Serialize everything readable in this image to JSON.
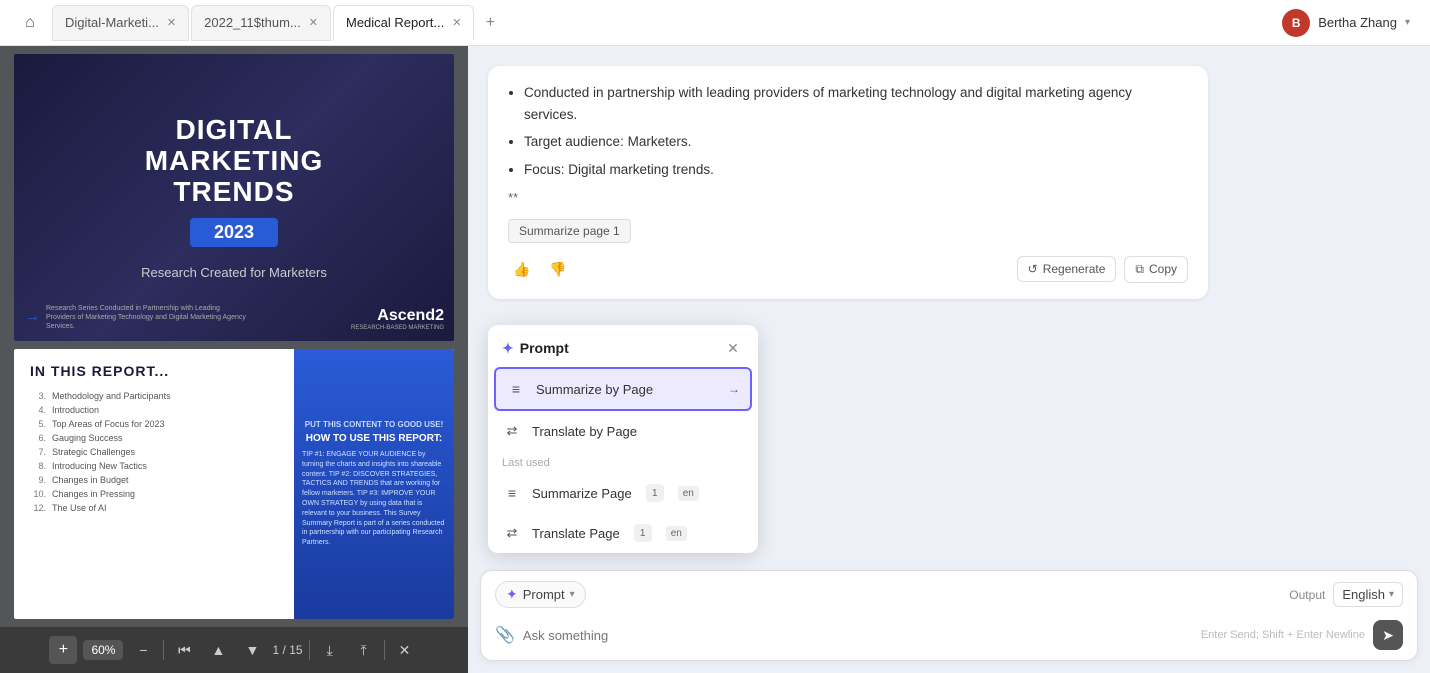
{
  "topbar": {
    "home_icon": "⌂",
    "tabs": [
      {
        "id": "tab-digital",
        "label": "Digital-Marketi...",
        "active": false,
        "closable": true
      },
      {
        "id": "tab-2022",
        "label": "2022_11$thum...",
        "active": false,
        "closable": true
      },
      {
        "id": "tab-medical",
        "label": "Medical Report...",
        "active": true,
        "closable": true
      }
    ],
    "add_tab_icon": "+",
    "user": {
      "initials": "B",
      "name": "Bertha Zhang",
      "chevron": "▾"
    }
  },
  "pdf": {
    "page1": {
      "title": "DIGITAL\nMARKETING\nTRENDS",
      "year": "2023",
      "subtitle": "Research Created for Marketers",
      "footer_left": "Research Series Conducted in Partnership with Leading Providers of Marketing Technology and Digital Marketing Agency Services.",
      "logo": "Ascend2",
      "logo_sub": "RESEARCH-BASED MARKETING"
    },
    "page2": {
      "header": "IN THIS REPORT...",
      "toc": [
        {
          "num": "3.",
          "label": "Methodology and Participants"
        },
        {
          "num": "4.",
          "label": "Introduction"
        },
        {
          "num": "5.",
          "label": "Top Areas of Focus for 2023"
        },
        {
          "num": "6.",
          "label": "Gauging Success"
        },
        {
          "num": "7.",
          "label": "Strategic Challenges"
        },
        {
          "num": "8.",
          "label": "Introducing New Tactics"
        },
        {
          "num": "9.",
          "label": "Changes in Budget"
        },
        {
          "num": "10.",
          "label": "Changes in Pressing"
        },
        {
          "num": "12.",
          "label": "The Use of AI"
        }
      ],
      "inset_label": "PUT THIS CONTENT TO GOOD USE!",
      "inset_title": "HOW TO USE THIS REPORT:",
      "inset_body": "TIP #1: ENGAGE YOUR AUDIENCE by turning the charts and insights into shareable content.\n\nTIP #2: DISCOVER STRATEGIES, TACTICS AND TRENDS that are working for fellow marketers.\n\nTIP #3: IMPROVE YOUR OWN STRATEGY by using data that is relevant to your business.\n\nThis Survey Summary Report is part of a series conducted in partnership with our participating Research Partners."
    },
    "toolbar": {
      "zoom": "60%",
      "page_current": "1",
      "page_total": "15"
    }
  },
  "chat": {
    "bubble": {
      "bullets": [
        "Conducted in partnership with leading providers of marketing technology and digital marketing agency services.",
        "Target audience: Marketers.",
        "Focus: Digital marketing trends."
      ],
      "double_star": "**",
      "badge_label": "Summarize page 1"
    },
    "actions": {
      "thumb_up": "👍",
      "thumb_down": "👎",
      "regenerate_label": "Regenerate",
      "copy_label": "Copy"
    }
  },
  "prompt_dropdown": {
    "title": "Prompt",
    "close_icon": "✕",
    "items": [
      {
        "id": "summarize-by-page",
        "icon": "≡",
        "label": "Summarize by Page",
        "selected": true
      },
      {
        "id": "translate-by-page",
        "icon": "⇄",
        "label": "Translate by Page",
        "selected": false
      }
    ],
    "section_label": "Last used",
    "last_used": [
      {
        "id": "summarize-page",
        "icon": "≡",
        "label": "Summarize Page",
        "badge": "1",
        "lang": "en"
      },
      {
        "id": "translate-page",
        "icon": "⇄",
        "label": "Translate Page",
        "badge": "1",
        "lang": "en"
      }
    ]
  },
  "bottom_bar": {
    "prompt_label": "Prompt",
    "output_label": "Output",
    "language": "English",
    "input_placeholder": "Ask something",
    "input_hint": "Enter Send; Shift + Enter Newline",
    "send_icon": "➤"
  }
}
